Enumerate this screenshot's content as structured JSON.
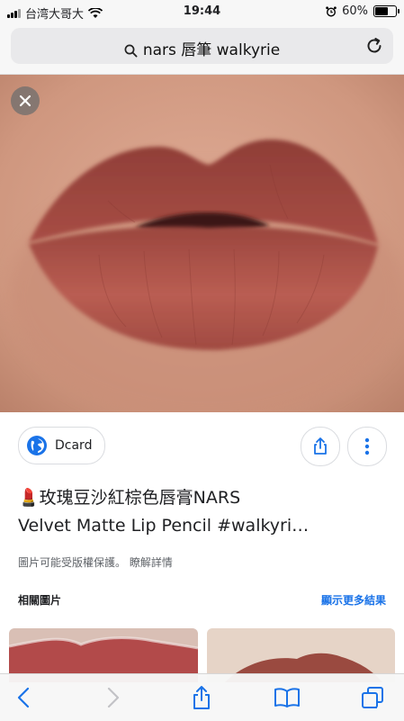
{
  "status_bar": {
    "carrier": "台湾大哥大",
    "time": "19:44",
    "battery": "60%"
  },
  "address_bar": {
    "query": "nars 唇筆 walkyrie"
  },
  "image_viewer": {
    "source_name": "Dcard",
    "title_line1": "💄玫瑰豆沙紅棕色唇膏NARS",
    "title_line2": "Velvet Matte Lip Pencil #walkyri…",
    "copyright_notice": "圖片可能受版權保護。 瞭解詳情",
    "related_heading": "相關圖片",
    "show_more": "顯示更多結果"
  },
  "colors": {
    "accent": "#1a73e8",
    "lip": "#b25a50",
    "skin": "#d8a38e"
  },
  "icons": [
    "search-icon",
    "reload-icon",
    "close-icon",
    "globe-icon",
    "share-icon",
    "more-vert-icon",
    "back-icon",
    "forward-icon",
    "share-toolbar-icon",
    "bookmarks-icon",
    "tabs-icon"
  ]
}
